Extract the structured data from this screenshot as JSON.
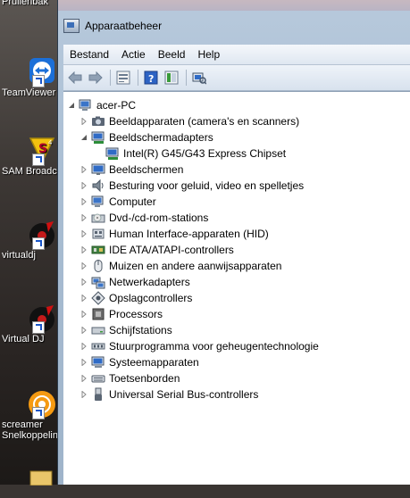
{
  "desktop": {
    "icons": [
      {
        "label": "Prullenbak",
        "icon": "recycle-bin"
      },
      {
        "label": "TeamViewer",
        "icon": "teamviewer"
      },
      {
        "label": "SAM Broadcaster",
        "icon": "sam-broadcaster"
      },
      {
        "label": "virtualdj",
        "icon": "virtual-dj"
      },
      {
        "label": "Virtual DJ",
        "icon": "virtual-dj"
      },
      {
        "label": "screamer",
        "icon": "screamer-radio"
      },
      {
        "label": "Snelkoppeling",
        "icon": "shortcut"
      }
    ]
  },
  "window": {
    "title": "Apparaatbeheer",
    "menu": [
      "Bestand",
      "Actie",
      "Beeld",
      "Help"
    ],
    "toolbar": [
      "back-icon",
      "forward-icon",
      "properties-icon",
      "help-icon",
      "view-icon",
      "scan-hardware-icon"
    ],
    "tree": {
      "root": "acer-PC",
      "items": [
        {
          "label": "Beeldapparaten (camera's en scanners)",
          "icon": "camera-icon",
          "expanded": false
        },
        {
          "label": "Beeldschermadapters",
          "icon": "display-adapter-icon",
          "expanded": true,
          "children": [
            {
              "label": "Intel(R) G45/G43 Express Chipset",
              "icon": "display-adapter-icon"
            }
          ]
        },
        {
          "label": "Beeldschermen",
          "icon": "monitor-icon",
          "expanded": false
        },
        {
          "label": "Besturing voor geluid, video en spelletjes",
          "icon": "speaker-icon",
          "expanded": false
        },
        {
          "label": "Computer",
          "icon": "computer-icon",
          "expanded": false
        },
        {
          "label": "Dvd-/cd-rom-stations",
          "icon": "dvd-drive-icon",
          "expanded": false
        },
        {
          "label": "Human Interface-apparaten (HID)",
          "icon": "hid-icon",
          "expanded": false
        },
        {
          "label": "IDE ATA/ATAPI-controllers",
          "icon": "ide-controller-icon",
          "expanded": false
        },
        {
          "label": "Muizen en andere aanwijsapparaten",
          "icon": "mouse-icon",
          "expanded": false
        },
        {
          "label": "Netwerkadapters",
          "icon": "network-adapter-icon",
          "expanded": false
        },
        {
          "label": "Opslagcontrollers",
          "icon": "storage-controller-icon",
          "expanded": false
        },
        {
          "label": "Processors",
          "icon": "processor-icon",
          "expanded": false
        },
        {
          "label": "Schijfstations",
          "icon": "disk-drive-icon",
          "expanded": false
        },
        {
          "label": "Stuurprogramma voor geheugentechnologie",
          "icon": "memory-driver-icon",
          "expanded": false
        },
        {
          "label": "Systeemapparaten",
          "icon": "system-device-icon",
          "expanded": false
        },
        {
          "label": "Toetsenborden",
          "icon": "keyboard-icon",
          "expanded": false
        },
        {
          "label": "Universal Serial Bus-controllers",
          "icon": "usb-icon",
          "expanded": false
        }
      ]
    }
  }
}
